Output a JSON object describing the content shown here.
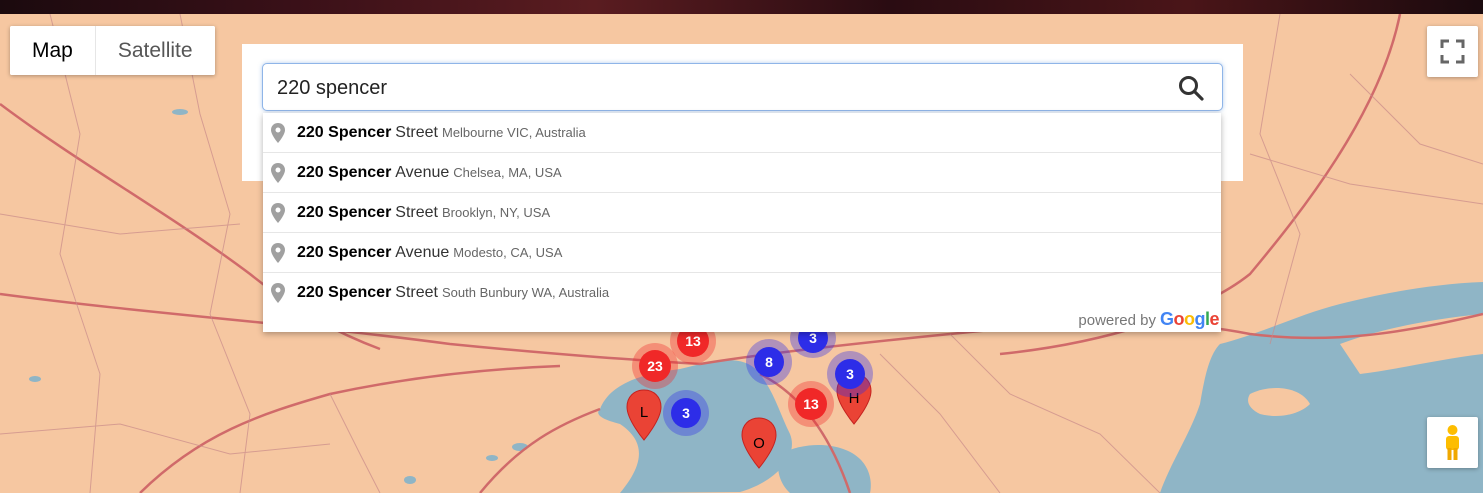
{
  "map_type_control": {
    "map_label": "Map",
    "satellite_label": "Satellite",
    "active": "Map"
  },
  "search": {
    "value": "220 spencer"
  },
  "suggestions": [
    {
      "number": "220",
      "match": "Spencer",
      "rest": "Street",
      "secondary": "Melbourne VIC, Australia"
    },
    {
      "number": "220",
      "match": "Spencer",
      "rest": "Avenue",
      "secondary": "Chelsea, MA, USA"
    },
    {
      "number": "220",
      "match": "Spencer",
      "rest": "Street",
      "secondary": "Brooklyn, NY, USA"
    },
    {
      "number": "220",
      "match": "Spencer",
      "rest": "Avenue",
      "secondary": "Modesto, CA, USA"
    },
    {
      "number": "220",
      "match": "Spencer",
      "rest": "Street",
      "secondary": "South Bunbury WA, Australia"
    }
  ],
  "attribution": {
    "powered_by": "powered by",
    "brand": "Google"
  },
  "clusters": [
    {
      "count": "13",
      "color": "#f02828"
    },
    {
      "count": "23",
      "color": "#f02828"
    },
    {
      "count": "3",
      "color": "#2d2de8"
    },
    {
      "count": "8",
      "color": "#2d2de8"
    },
    {
      "count": "3",
      "color": "#2d2de8"
    },
    {
      "count": "3",
      "color": "#2d2de8"
    },
    {
      "count": "13",
      "color": "#f02828"
    }
  ],
  "markers": [
    {
      "label": "L",
      "color": "#ea4335"
    },
    {
      "label": "O",
      "color": "#ea4335"
    },
    {
      "label": "H",
      "color": "#ea4335"
    }
  ],
  "colors": {
    "land": "#f6c7a1",
    "water": "#8fb5c6",
    "road": "#d06a6a",
    "accent_border": "#8fb5e8"
  },
  "icons": [
    "search-icon",
    "fullscreen-icon",
    "pegman-icon",
    "pin-icon",
    "map-marker-icon"
  ]
}
